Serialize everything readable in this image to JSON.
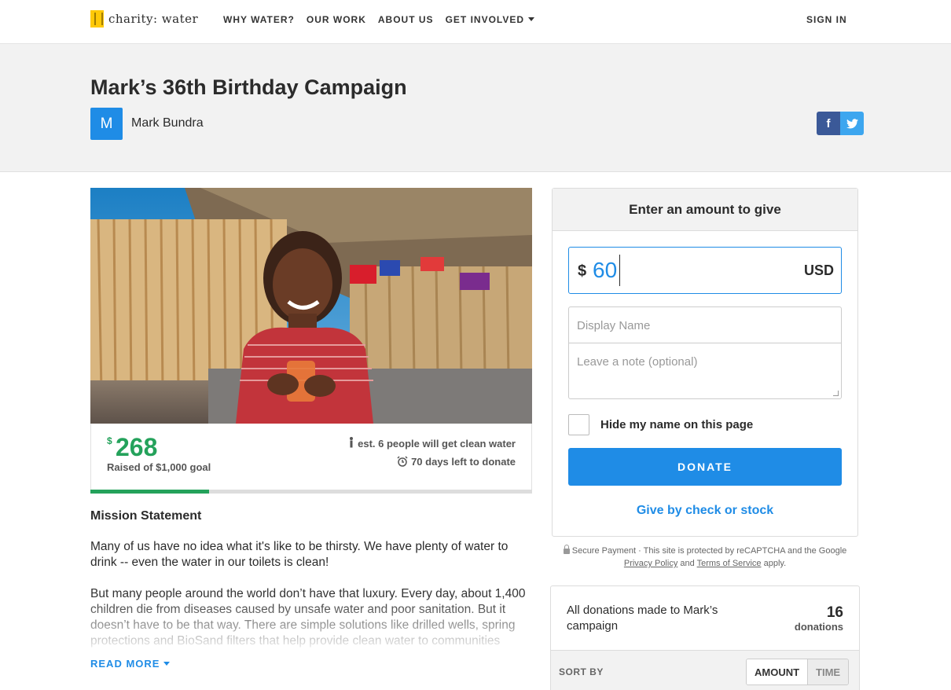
{
  "nav": {
    "logo_text": "charity: water",
    "links": [
      "WHY WATER?",
      "OUR WORK",
      "ABOUT US",
      "GET INVOLVED"
    ],
    "sign_in": "SIGN IN"
  },
  "campaign": {
    "title": "Mark’s 36th Birthday Campaign",
    "owner_initial": "M",
    "owner_name": "Mark Bundra"
  },
  "share": {
    "facebook": "f",
    "twitter": "t"
  },
  "stats": {
    "currency": "$",
    "raised": "268",
    "goal_text": "Raised of $1,000 goal",
    "impact_text": "est. 6 people will get clean water",
    "days_text": "70 days left to donate",
    "progress_fraction": 0.268
  },
  "mission": {
    "heading": "Mission Statement",
    "p1": "Many of us have no idea what it's like to be thirsty. We have plenty of water to drink -- even the water in our toilets is clean!",
    "p2": "But many people around the world don’t have that luxury. Every day, about 1,400 children die from diseases caused by unsafe water and poor sanitation. But it doesn’t have to be that way. There are simple solutions like drilled wells, spring protections and BioSand filters that help provide clean water to communities",
    "read_more": "READ MORE"
  },
  "donate": {
    "heading": "Enter an amount to give",
    "currency_symbol": "$",
    "amount": "60",
    "currency_code": "USD",
    "name_placeholder": "Display Name",
    "note_placeholder": "Leave a note (optional)",
    "hide_name_label": "Hide my name on this page",
    "button": "DONATE",
    "check_link": "Give by check or stock"
  },
  "secure": {
    "text": "Secure Payment · This site is protected by reCAPTCHA and the Google",
    "privacy": "Privacy Policy",
    "and": "and",
    "terms": "Terms of Service",
    "apply": "apply."
  },
  "donations": {
    "title": "All donations made to Mark’s campaign",
    "count": "16",
    "count_label": "donations",
    "sort_label": "SORT BY",
    "sort_options": [
      "AMOUNT",
      "TIME"
    ]
  },
  "colors": {
    "brand_blue": "#1f8ce6",
    "progress_green": "#24a25b",
    "logo_yellow": "#ffc907"
  }
}
